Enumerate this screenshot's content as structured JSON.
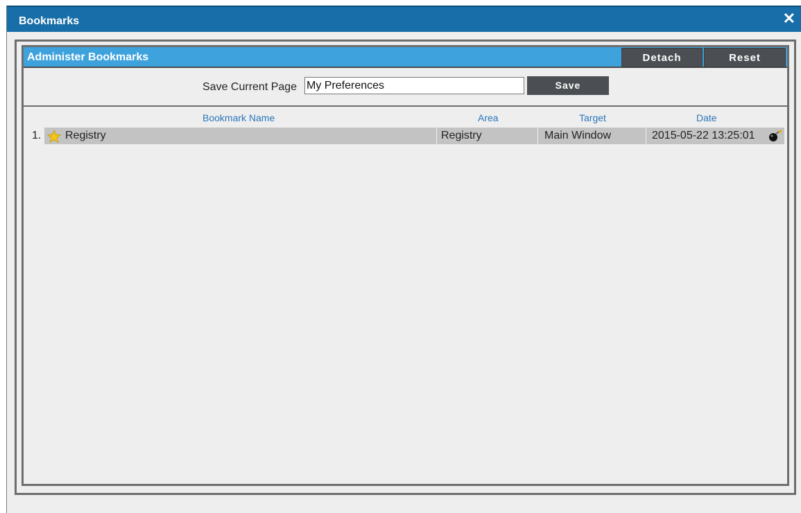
{
  "window": {
    "title": "Bookmarks",
    "close_glyph": "✕"
  },
  "panel": {
    "title": "Administer Bookmarks",
    "detach_label": "Detach",
    "reset_label": "Reset"
  },
  "save": {
    "label": "Save Current Page",
    "input_value": "My Preferences",
    "button_label": "Save"
  },
  "table": {
    "columns": [
      "Bookmark Name",
      "Area",
      "Target",
      "Date"
    ],
    "rows": [
      {
        "index": "1.",
        "name": "Registry",
        "area": "Registry",
        "target": "Main Window",
        "date": "2015-05-22 13:25:01",
        "icon": "star-icon",
        "action_icon": "bomb-delete-icon"
      }
    ]
  },
  "colors": {
    "titlebar": "#186ea8",
    "panel_header": "#3ea2dd",
    "button": "#4b4f53",
    "column_header_text": "#2a77bb",
    "row_background": "#c3c3c3"
  }
}
